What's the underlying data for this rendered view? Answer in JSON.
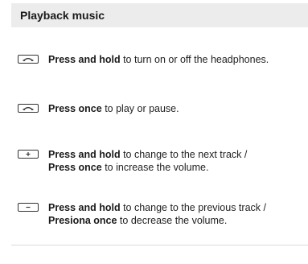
{
  "section": {
    "title": "Playback music"
  },
  "items": [
    {
      "icon": "power-phone-icon",
      "bold1": "Press and hold",
      "text1": " to turn on or off the headphones.",
      "bold2": "",
      "text2": ""
    },
    {
      "icon": "power-phone-icon",
      "bold1": "Press once",
      "text1": " to play or pause.",
      "bold2": "",
      "text2": ""
    },
    {
      "icon": "plus-icon",
      "bold1": "Press and hold",
      "text1": " to change to the next track /",
      "bold2": "Press once",
      "text2": " to increase the volume."
    },
    {
      "icon": "minus-icon",
      "bold1": "Press and hold",
      "text1": " to change to the previous track /",
      "bold2": "Presiona once",
      "text2": " to decrease the volume."
    }
  ]
}
